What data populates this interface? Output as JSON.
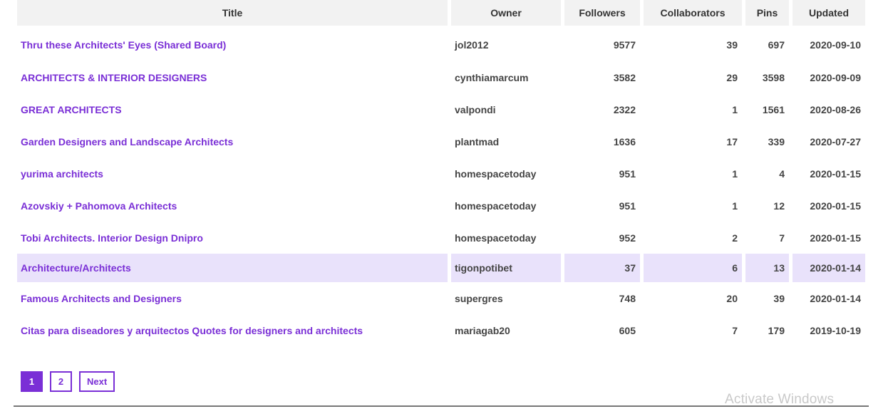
{
  "table": {
    "headers": [
      "Title",
      "Owner",
      "Followers",
      "Collaborators",
      "Pins",
      "Updated"
    ],
    "rows": [
      {
        "title": "Thru these Architects' Eyes (Shared Board)",
        "owner": "jol2012",
        "followers": "9577",
        "collaborators": "39",
        "pins": "697",
        "updated": "2020-09-10"
      },
      {
        "title": "ARCHITECTS & INTERIOR DESIGNERS",
        "owner": "cynthiamarcum",
        "followers": "3582",
        "collaborators": "29",
        "pins": "3598",
        "updated": "2020-09-09"
      },
      {
        "title": "GREAT ARCHITECTS",
        "owner": "valpondi",
        "followers": "2322",
        "collaborators": "1",
        "pins": "1561",
        "updated": "2020-08-26"
      },
      {
        "title": "Garden Designers and Landscape Architects",
        "owner": "plantmad",
        "followers": "1636",
        "collaborators": "17",
        "pins": "339",
        "updated": "2020-07-27"
      },
      {
        "title": "yurima architects",
        "owner": "homespacetoday",
        "followers": "951",
        "collaborators": "1",
        "pins": "4",
        "updated": "2020-01-15"
      },
      {
        "title": "Azovskiy + Pahomova Architects",
        "owner": "homespacetoday",
        "followers": "951",
        "collaborators": "1",
        "pins": "12",
        "updated": "2020-01-15"
      },
      {
        "title": "Tobi Architects. Interior Design Dnipro",
        "owner": "homespacetoday",
        "followers": "952",
        "collaborators": "2",
        "pins": "7",
        "updated": "2020-01-15"
      },
      {
        "title": "Architecture/Architects",
        "owner": "tigonpotibet",
        "followers": "37",
        "collaborators": "6",
        "pins": "13",
        "updated": "2020-01-14"
      },
      {
        "title": "Famous Architects and Designers",
        "owner": "supergres",
        "followers": "748",
        "collaborators": "20",
        "pins": "39",
        "updated": "2020-01-14"
      },
      {
        "title": "Citas para diseadores y arquitectos Quotes for designers and architects",
        "owner": "mariagab20",
        "followers": "605",
        "collaborators": "7",
        "pins": "179",
        "updated": "2019-10-19"
      }
    ],
    "highlighted_row_index": 7
  },
  "pagination": {
    "pages": [
      "1",
      "2"
    ],
    "current_page": "1",
    "next_label": "Next"
  },
  "watermark": "Activate Windows",
  "colors": {
    "accent": "#7a2fd6",
    "header_bg": "#f2f2f2",
    "highlight_bg": "#e9e2fb",
    "text": "#444444"
  }
}
